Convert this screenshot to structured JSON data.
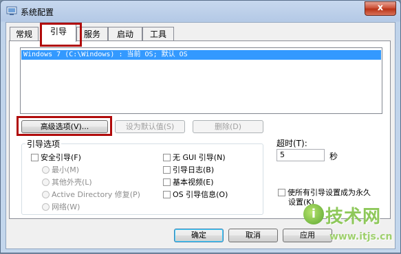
{
  "window": {
    "title": "系统配置",
    "close_glyph": "x"
  },
  "tabs": [
    {
      "label": "常规",
      "active": false
    },
    {
      "label": "引导",
      "active": true
    },
    {
      "label": "服务",
      "active": false
    },
    {
      "label": "启动",
      "active": false
    },
    {
      "label": "工具",
      "active": false
    }
  ],
  "os_list": {
    "items": [
      "Windows 7 (C:\\Windows) : 当前 OS; 默认 OS"
    ]
  },
  "buttons": {
    "advanced": "高级选项(V)...",
    "set_default": "设为默认值(S)",
    "delete": "删除(D)",
    "ok": "确定",
    "cancel": "取消",
    "apply": "应用"
  },
  "boot_options": {
    "title": "引导选项",
    "safe_boot": "安全引导(F)",
    "minimal": "最小(M)",
    "alternate_shell": "其他外壳(L)",
    "active_directory": "Active Directory 修复(P)",
    "network": "网络(W)",
    "no_gui": "无 GUI 引导(N)",
    "boot_log": "引导日志(B)",
    "base_video": "基本视频(E)",
    "os_boot_info": "OS 引导信息(O)"
  },
  "timeout": {
    "label": "超时(T):",
    "value": "5",
    "unit": "秒"
  },
  "permanent": {
    "label_line1": "使所有引导设置成为永久",
    "label_line2": "设置(K)"
  },
  "watermark": {
    "logo_letter": "i",
    "text": "技术网",
    "url": "www.itjs.cn"
  },
  "colors": {
    "selection": "#3399ff",
    "highlight_box": "#b00a0a",
    "watermark": "#8ec85a"
  }
}
